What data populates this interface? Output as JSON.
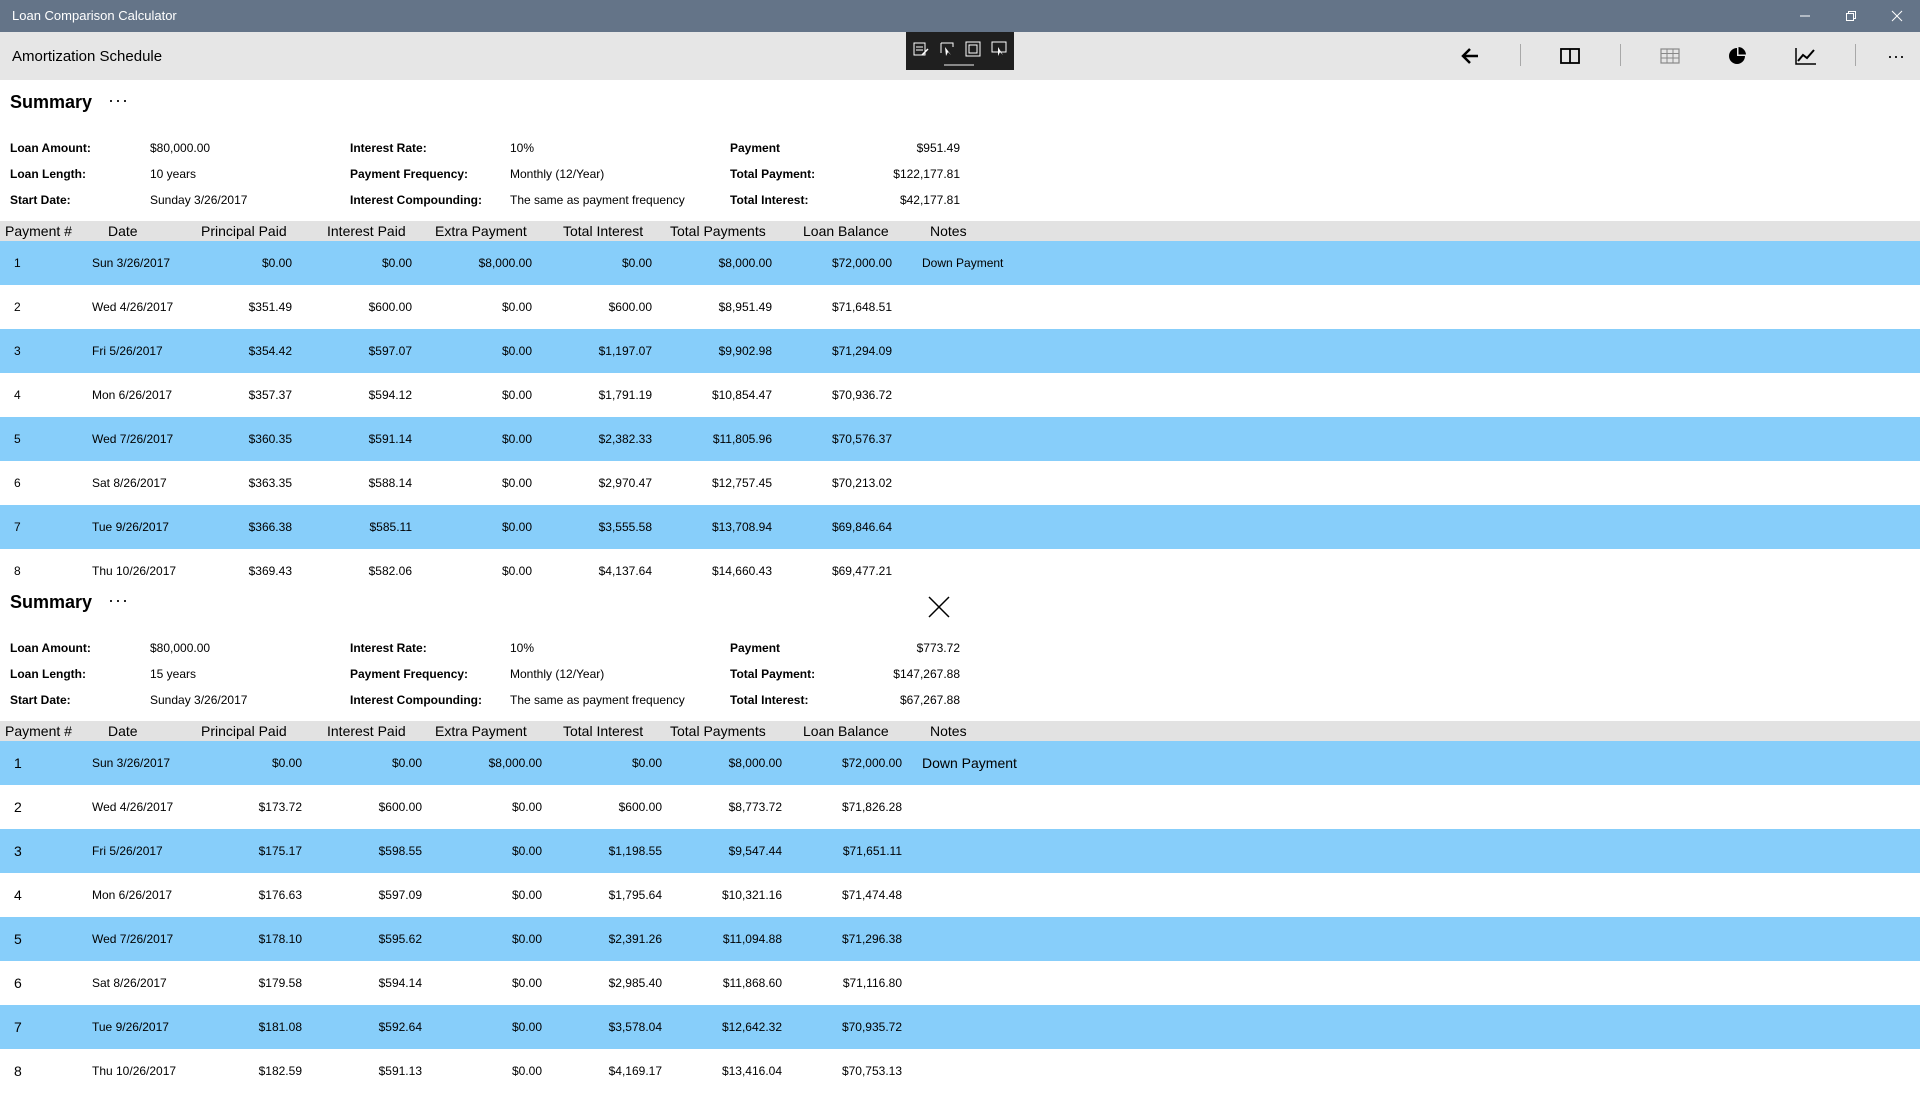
{
  "app": {
    "title": "Loan Comparison Calculator",
    "window_buttons": [
      "minimize-icon",
      "restore-icon",
      "close-icon"
    ]
  },
  "commandbar": {
    "page_title": "Amortization Schedule",
    "capture_tools": [
      "edit-capture-icon",
      "freeform-select-icon",
      "window-capture-icon",
      "screen-capture-icon"
    ],
    "buttons": [
      "back-arrow-icon",
      "split-view-icon",
      "table-icon",
      "pie-chart-icon",
      "line-chart-icon",
      "more-icon"
    ],
    "more_label": "···"
  },
  "columns": [
    "Payment #",
    "Date",
    "Principal Paid",
    "Interest Paid",
    "Extra Payment",
    "Total Interest",
    "Total Payments",
    "Loan Balance",
    "Notes"
  ],
  "schedules": [
    {
      "summary_title": "Summary",
      "more_label": "···",
      "labels": {
        "loan_amount": "Loan Amount:",
        "loan_length": "Loan Length:",
        "start_date": "Start Date:",
        "interest_rate": "Interest Rate:",
        "payment_frequency": "Payment Frequency:",
        "interest_compounding": "Interest Compounding:",
        "payment": "Payment",
        "total_payment": "Total Payment:",
        "total_interest": "Total Interest:"
      },
      "values": {
        "loan_amount": "$80,000.00",
        "loan_length": "10 years",
        "start_date": "Sunday 3/26/2017",
        "interest_rate": "10%",
        "payment_frequency": "Monthly (12/Year)",
        "interest_compounding": "The same as payment frequency",
        "payment": "$951.49",
        "total_payment": "$122,177.81",
        "total_interest": "$42,177.81"
      },
      "rows": [
        [
          "1",
          "Sun 3/26/2017",
          "$0.00",
          "$0.00",
          "$8,000.00",
          "$0.00",
          "$8,000.00",
          "$72,000.00",
          "Down Payment"
        ],
        [
          "2",
          "Wed 4/26/2017",
          "$351.49",
          "$600.00",
          "$0.00",
          "$600.00",
          "$8,951.49",
          "$71,648.51",
          ""
        ],
        [
          "3",
          "Fri 5/26/2017",
          "$354.42",
          "$597.07",
          "$0.00",
          "$1,197.07",
          "$9,902.98",
          "$71,294.09",
          ""
        ],
        [
          "4",
          "Mon 6/26/2017",
          "$357.37",
          "$594.12",
          "$0.00",
          "$1,791.19",
          "$10,854.47",
          "$70,936.72",
          ""
        ],
        [
          "5",
          "Wed 7/26/2017",
          "$360.35",
          "$591.14",
          "$0.00",
          "$2,382.33",
          "$11,805.96",
          "$70,576.37",
          ""
        ],
        [
          "6",
          "Sat 8/26/2017",
          "$363.35",
          "$588.14",
          "$0.00",
          "$2,970.47",
          "$12,757.45",
          "$70,213.02",
          ""
        ],
        [
          "7",
          "Tue 9/26/2017",
          "$366.38",
          "$585.11",
          "$0.00",
          "$3,555.58",
          "$13,708.94",
          "$69,846.64",
          ""
        ],
        [
          "8",
          "Thu 10/26/2017",
          "$369.43",
          "$582.06",
          "$0.00",
          "$4,137.64",
          "$14,660.43",
          "$69,477.21",
          ""
        ]
      ]
    },
    {
      "summary_title": "Summary",
      "more_label": "···",
      "labels": {
        "loan_amount": "Loan Amount:",
        "loan_length": "Loan Length:",
        "start_date": "Start Date:",
        "interest_rate": "Interest Rate:",
        "payment_frequency": "Payment Frequency:",
        "interest_compounding": "Interest Compounding:",
        "payment": "Payment",
        "total_payment": "Total Payment:",
        "total_interest": "Total Interest:"
      },
      "values": {
        "loan_amount": "$80,000.00",
        "loan_length": "15 years",
        "start_date": "Sunday 3/26/2017",
        "interest_rate": "10%",
        "payment_frequency": "Monthly (12/Year)",
        "interest_compounding": "The same as payment frequency",
        "payment": "$773.72",
        "total_payment": "$147,267.88",
        "total_interest": "$67,267.88"
      },
      "rows": [
        [
          "1",
          "Sun 3/26/2017",
          "$0.00",
          "$0.00",
          "$8,000.00",
          "$0.00",
          "$8,000.00",
          "$72,000.00",
          "Down Payment"
        ],
        [
          "2",
          "Wed 4/26/2017",
          "$173.72",
          "$600.00",
          "$0.00",
          "$600.00",
          "$8,773.72",
          "$71,826.28",
          ""
        ],
        [
          "3",
          "Fri 5/26/2017",
          "$175.17",
          "$598.55",
          "$0.00",
          "$1,198.55",
          "$9,547.44",
          "$71,651.11",
          ""
        ],
        [
          "4",
          "Mon 6/26/2017",
          "$176.63",
          "$597.09",
          "$0.00",
          "$1,795.64",
          "$10,321.16",
          "$71,474.48",
          ""
        ],
        [
          "5",
          "Wed 7/26/2017",
          "$178.10",
          "$595.62",
          "$0.00",
          "$2,391.26",
          "$11,094.88",
          "$71,296.38",
          ""
        ],
        [
          "6",
          "Sat 8/26/2017",
          "$179.58",
          "$594.14",
          "$0.00",
          "$2,985.40",
          "$11,868.60",
          "$71,116.80",
          ""
        ],
        [
          "7",
          "Tue 9/26/2017",
          "$181.08",
          "$592.64",
          "$0.00",
          "$3,578.04",
          "$12,642.32",
          "$70,935.72",
          ""
        ],
        [
          "8",
          "Thu 10/26/2017",
          "$182.59",
          "$591.13",
          "$0.00",
          "$4,169.17",
          "$13,416.04",
          "$70,753.13",
          ""
        ]
      ]
    }
  ],
  "colors": {
    "titlebar": "#647488",
    "commandbar": "#e6e6e6",
    "row_highlight": "#87cefa",
    "header_row": "#e2e2e2"
  }
}
